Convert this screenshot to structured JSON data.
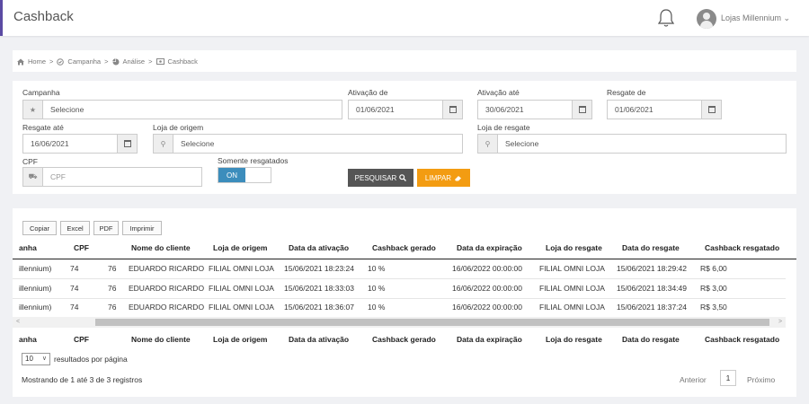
{
  "header": {
    "title": "Cashback",
    "user_name": "Lojas Millennium",
    "user_chevron": "⌄"
  },
  "breadcrumb": {
    "items": [
      {
        "label": "Home",
        "icon": "home-icon"
      },
      {
        "label": "Campanha",
        "icon": "campaign-icon"
      },
      {
        "label": "Análise",
        "icon": "pie-chart-icon"
      },
      {
        "label": "Cashback",
        "icon": "cashback-icon"
      }
    ],
    "separator": ">"
  },
  "filters": {
    "campanha": {
      "label": "Campanha",
      "placeholder": "Selecione"
    },
    "ativacao_de": {
      "label": "Ativação de",
      "value": "01/06/2021"
    },
    "ativacao_ate": {
      "label": "Ativação até",
      "value": "30/06/2021"
    },
    "resgate_de": {
      "label": "Resgate de",
      "value": "01/06/2021"
    },
    "resgate_ate": {
      "label": "Resgate até",
      "value": "16/06/2021"
    },
    "loja_origem": {
      "label": "Loja de origem",
      "placeholder": "Selecione"
    },
    "loja_resgate": {
      "label": "Loja de resgate",
      "placeholder": "Selecione"
    },
    "cpf": {
      "label": "CPF",
      "placeholder": "CPF"
    },
    "somente_resgatados": {
      "label": "Somente resgatados",
      "state": "ON"
    },
    "search_button": "PESQUISAR",
    "clear_button": "LIMPAR"
  },
  "export_buttons": [
    "Copiar",
    "Excel",
    "PDF",
    "Imprimir"
  ],
  "table": {
    "columns": [
      "anha",
      "CPF",
      "Nome do cliente",
      "Loja de origem",
      "Data da ativação",
      "Cashback gerado",
      "Data da expiração",
      "Loja do resgate",
      "Data do resgate",
      "Cashback resgatado"
    ],
    "rows": [
      [
        "illennium)",
        "74",
        "76",
        "EDUARDO RICARDO",
        "FILIAL OMNI LOJA",
        "15/06/2021 18:23:24",
        "10 %",
        "16/06/2022 00:00:00",
        "FILIAL OMNI LOJA",
        "15/06/2021 18:29:42",
        "R$ 6,00"
      ],
      [
        "illennium)",
        "74",
        "76",
        "EDUARDO RICARDO",
        "FILIAL OMNI LOJA",
        "15/06/2021 18:33:03",
        "10 %",
        "16/06/2022 00:00:00",
        "FILIAL OMNI LOJA",
        "15/06/2021 18:34:49",
        "R$ 3,00"
      ],
      [
        "illennium)",
        "74",
        "76",
        "EDUARDO RICARDO",
        "FILIAL OMNI LOJA",
        "15/06/2021 18:36:07",
        "10 %",
        "16/06/2022 00:00:00",
        "FILIAL OMNI LOJA",
        "15/06/2021 18:37:24",
        "R$ 3,50"
      ]
    ]
  },
  "pagination": {
    "page_size": "10",
    "page_size_label": "resultados por página",
    "info": "Mostrando de 1 até 3 de 3 registros",
    "prev": "Anterior",
    "current_page": "1",
    "next": "Próximo"
  },
  "colors": {
    "accent": "#5b4ba3",
    "primary": "#3c8dbc",
    "clear": "#f39c12",
    "search": "#555555"
  }
}
